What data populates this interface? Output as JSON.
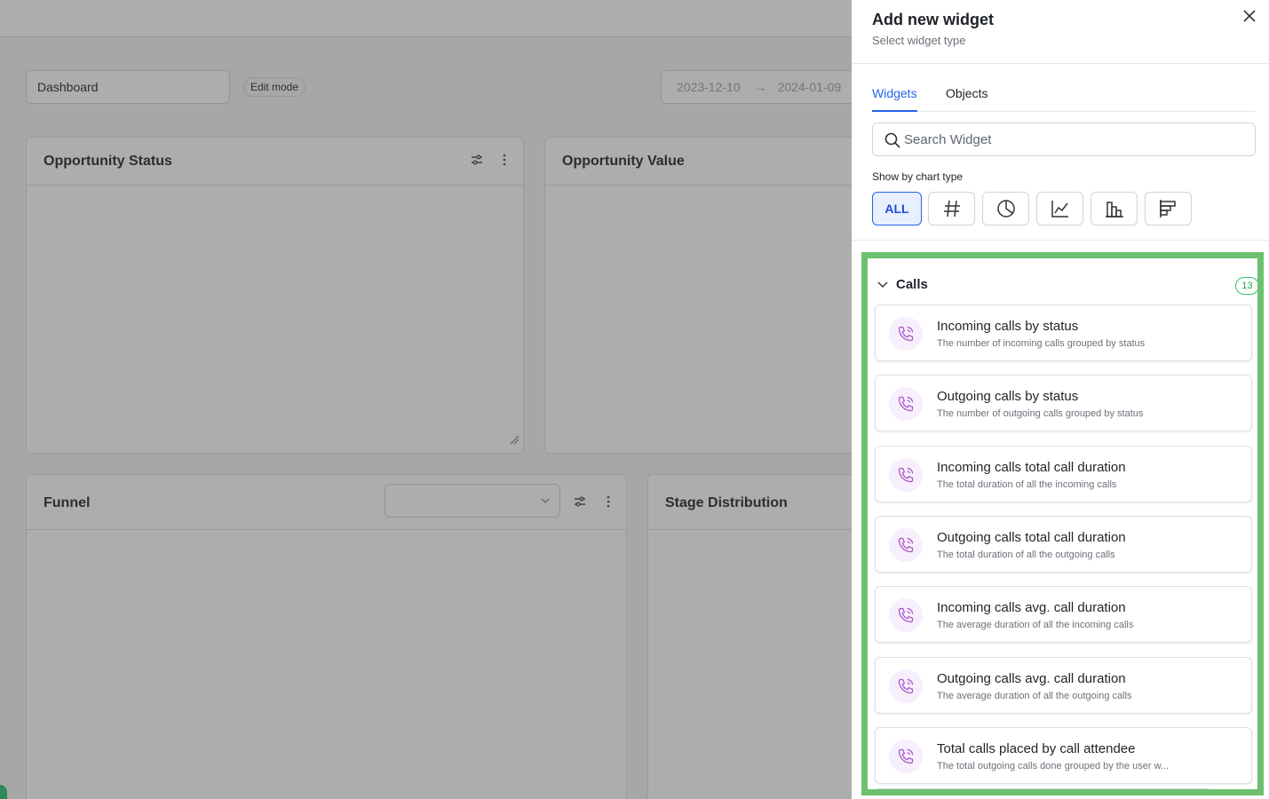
{
  "dashboard": {
    "name": "Dashboard",
    "edit_mode": "Edit mode",
    "date_from": "2023-12-10",
    "date_to": "2024-01-09",
    "cards": [
      {
        "title": "Opportunity Status"
      },
      {
        "title": "Opportunity Value"
      },
      {
        "title": "Funnel"
      },
      {
        "title": "Stage Distribution"
      }
    ]
  },
  "drawer": {
    "title": "Add new widget",
    "subtitle": "Select widget type",
    "tabs": [
      {
        "label": "Widgets",
        "active": true
      },
      {
        "label": "Objects",
        "active": false
      }
    ],
    "search": {
      "placeholder": "Search Widget",
      "value": ""
    },
    "chart_type_label": "Show by chart type",
    "chart_types": [
      {
        "label": "ALL",
        "icon": "all",
        "active": true
      },
      {
        "label": "",
        "icon": "hash-icon"
      },
      {
        "label": "",
        "icon": "pie-chart-icon"
      },
      {
        "label": "",
        "icon": "line-chart-icon"
      },
      {
        "label": "",
        "icon": "bar-chart-icon"
      },
      {
        "label": "",
        "icon": "horizontal-bar-chart-icon"
      }
    ],
    "group": {
      "name": "Calls",
      "count": "13",
      "items": [
        {
          "title": "Incoming calls by status",
          "description": "The number of incoming calls grouped by status"
        },
        {
          "title": "Outgoing calls by status",
          "description": "The number of outgoing calls grouped by status"
        },
        {
          "title": "Incoming calls total call duration",
          "description": "The total duration of all the incoming calls"
        },
        {
          "title": "Outgoing calls total call duration",
          "description": "The total duration of all the outgoing calls"
        },
        {
          "title": "Incoming calls avg. call duration",
          "description": "The average duration of all the incoming calls"
        },
        {
          "title": "Outgoing calls avg. call duration",
          "description": "The average duration of all the outgoing calls"
        },
        {
          "title": "Total calls placed by call attendee",
          "description": "The total outgoing calls done grouped by the user w..."
        }
      ]
    }
  },
  "colors": {
    "accent": "#2563eb",
    "highlight": "#6cc06f",
    "count_badge": "#22a35a",
    "phone_icon": "#a855c7"
  }
}
